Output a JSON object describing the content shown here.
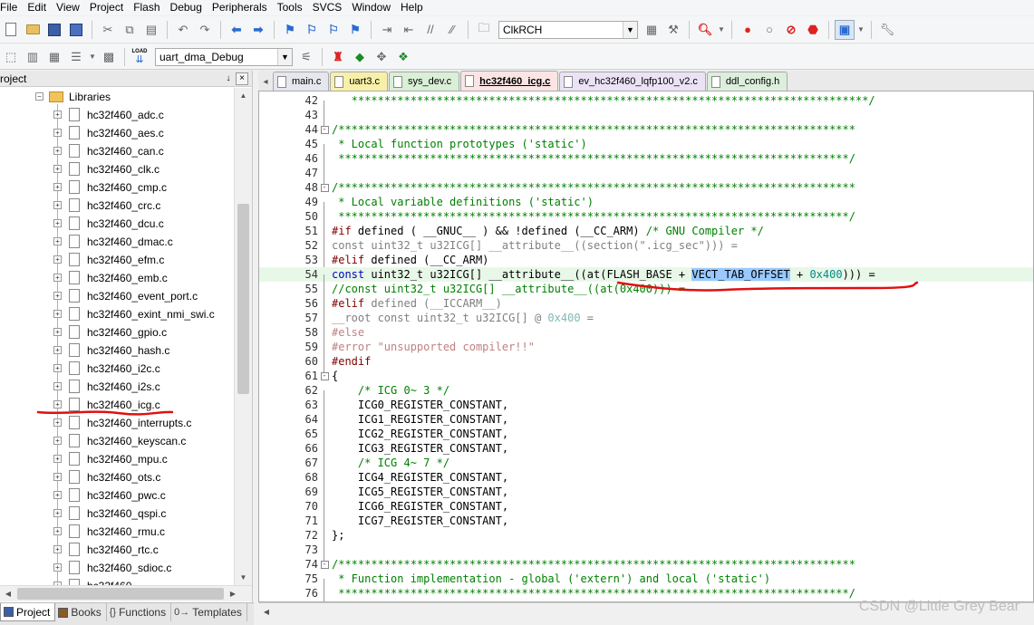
{
  "menubar": [
    "File",
    "Edit",
    "View",
    "Project",
    "Flash",
    "Debug",
    "Peripherals",
    "Tools",
    "SVCS",
    "Window",
    "Help"
  ],
  "toolbar1": {
    "target_value": "ClkRCH"
  },
  "toolbar2": {
    "target_config": "uart_dma_Debug",
    "load_label": "LOAD"
  },
  "project_panel": {
    "title": "roject",
    "pin": "↓",
    "close": "×",
    "libraries_folder": "Libraries",
    "files": [
      "hc32f460_adc.c",
      "hc32f460_aes.c",
      "hc32f460_can.c",
      "hc32f460_clk.c",
      "hc32f460_cmp.c",
      "hc32f460_crc.c",
      "hc32f460_dcu.c",
      "hc32f460_dmac.c",
      "hc32f460_efm.c",
      "hc32f460_emb.c",
      "hc32f460_event_port.c",
      "hc32f460_exint_nmi_swi.c",
      "hc32f460_gpio.c",
      "hc32f460_hash.c",
      "hc32f460_i2c.c",
      "hc32f460_i2s.c",
      "hc32f460_icg.c",
      "hc32f460_interrupts.c",
      "hc32f460_keyscan.c",
      "hc32f460_mpu.c",
      "hc32f460_ots.c",
      "hc32f460_pwc.c",
      "hc32f460_qspi.c",
      "hc32f460_rmu.c",
      "hc32f460_rtc.c",
      "hc32f460_sdioc.c",
      "hc32f460_..."
    ]
  },
  "bottom_tabs": [
    {
      "label": "Project",
      "icon": "project-icon"
    },
    {
      "label": "Books",
      "icon": "books-icon"
    },
    {
      "label": "Functions",
      "icon": "functions-icon",
      "glyph": "{}"
    },
    {
      "label": "Templates",
      "icon": "templates-icon",
      "glyph": "0→"
    }
  ],
  "editor_tabs": [
    {
      "label": "main.c",
      "color": "#e6e6ef"
    },
    {
      "label": "uart3.c",
      "color": "#f8f0a8"
    },
    {
      "label": "sys_dev.c",
      "color": "#d9efd6"
    },
    {
      "label": "hc32f460_icg.c",
      "color": "#fbe4e4",
      "active": true
    },
    {
      "label": "ev_hc32f460_lqfp100_v2.c",
      "color": "#ece2f6"
    },
    {
      "label": "ddl_config.h",
      "color": "#dcefdc"
    }
  ],
  "code": [
    {
      "n": "42",
      "t": [
        [
          "cm",
          "   *******************************************************************************/"
        ]
      ]
    },
    {
      "n": "43",
      "t": []
    },
    {
      "n": "44",
      "fold": "-",
      "t": [
        [
          "cm",
          "/*******************************************************************************"
        ]
      ]
    },
    {
      "n": "45",
      "t": [
        [
          "cm",
          " * Local function prototypes ('static')"
        ]
      ]
    },
    {
      "n": "46",
      "t": [
        [
          "cm",
          " ******************************************************************************/"
        ]
      ]
    },
    {
      "n": "47",
      "t": []
    },
    {
      "n": "48",
      "fold": "-",
      "t": [
        [
          "cm",
          "/*******************************************************************************"
        ]
      ]
    },
    {
      "n": "49",
      "t": [
        [
          "cm",
          " * Local variable definitions ('static')"
        ]
      ]
    },
    {
      "n": "50",
      "t": [
        [
          "cm",
          " ******************************************************************************/"
        ]
      ]
    },
    {
      "n": "51",
      "t": [
        [
          "pp",
          "#if "
        ],
        [
          "pl",
          "defined ( __GNUC__ ) && !defined (__CC_ARM) "
        ],
        [
          "cm",
          "/* GNU Compiler */"
        ]
      ]
    },
    {
      "n": "52",
      "t": [
        [
          "gr",
          "const uint32_t u32ICG[] __attribute__((section(\".icg_sec\"))) ="
        ]
      ]
    },
    {
      "n": "53",
      "t": [
        [
          "pp",
          "#elif "
        ],
        [
          "pl",
          "defined (__CC_ARM)"
        ]
      ]
    },
    {
      "n": "54",
      "hl": true,
      "t": [
        [
          "kw",
          "const "
        ],
        [
          "pl",
          "uint32_t u32ICG[] __attribute__((at(FLASH_BASE + "
        ],
        [
          "sel",
          "VECT_TAB_OFFSET"
        ],
        [
          "pl",
          " + "
        ],
        [
          "nm",
          "0x400"
        ],
        [
          "pl",
          "))) ="
        ]
      ]
    },
    {
      "n": "55",
      "t": [
        [
          "cm",
          "//const uint32_t u32ICG[] __attribute__((at(0x400))) ="
        ]
      ]
    },
    {
      "n": "56",
      "t": [
        [
          "pp",
          "#elif "
        ],
        [
          "gr",
          "defined (__ICCARM__)"
        ]
      ]
    },
    {
      "n": "57",
      "t": [
        [
          "gr",
          "__root const uint32_t u32ICG[] @ "
        ],
        [
          "nmg",
          "0x400"
        ],
        [
          "gr",
          " ="
        ]
      ]
    },
    {
      "n": "58",
      "t": [
        [
          "ppg",
          "#else"
        ]
      ]
    },
    {
      "n": "59",
      "t": [
        [
          "ppg",
          "#error "
        ],
        [
          "stg",
          "\"unsupported compiler!!\""
        ]
      ]
    },
    {
      "n": "60",
      "t": [
        [
          "pp",
          "#endif"
        ]
      ]
    },
    {
      "n": "61",
      "fold": "-",
      "t": [
        [
          "pl",
          "{"
        ]
      ]
    },
    {
      "n": "62",
      "t": [
        [
          "cm",
          "    /* ICG 0~ 3 */"
        ]
      ]
    },
    {
      "n": "63",
      "t": [
        [
          "pl",
          "    ICG0_REGISTER_CONSTANT,"
        ]
      ]
    },
    {
      "n": "64",
      "t": [
        [
          "pl",
          "    ICG1_REGISTER_CONSTANT,"
        ]
      ]
    },
    {
      "n": "65",
      "t": [
        [
          "pl",
          "    ICG2_REGISTER_CONSTANT,"
        ]
      ]
    },
    {
      "n": "66",
      "t": [
        [
          "pl",
          "    ICG3_REGISTER_CONSTANT,"
        ]
      ]
    },
    {
      "n": "67",
      "t": [
        [
          "cm",
          "    /* ICG 4~ 7 */"
        ]
      ]
    },
    {
      "n": "68",
      "t": [
        [
          "pl",
          "    ICG4_REGISTER_CONSTANT,"
        ]
      ]
    },
    {
      "n": "69",
      "t": [
        [
          "pl",
          "    ICG5_REGISTER_CONSTANT,"
        ]
      ]
    },
    {
      "n": "70",
      "t": [
        [
          "pl",
          "    ICG6_REGISTER_CONSTANT,"
        ]
      ]
    },
    {
      "n": "71",
      "t": [
        [
          "pl",
          "    ICG7_REGISTER_CONSTANT,"
        ]
      ]
    },
    {
      "n": "72",
      "t": [
        [
          "pl",
          "};"
        ]
      ]
    },
    {
      "n": "73",
      "t": []
    },
    {
      "n": "74",
      "fold": "-",
      "t": [
        [
          "cm",
          "/*******************************************************************************"
        ]
      ]
    },
    {
      "n": "75",
      "t": [
        [
          "cm",
          " * Function implementation - global ('extern') and local ('static')"
        ]
      ]
    },
    {
      "n": "76",
      "t": [
        [
          "cm",
          " ******************************************************************************/"
        ]
      ]
    }
  ],
  "watermark": "CSDN @Little Grey Bear",
  "colors": {
    "annotation_red": "#e01010",
    "selection": "#99c9ff",
    "highlight_line": "#e8f8e8"
  }
}
